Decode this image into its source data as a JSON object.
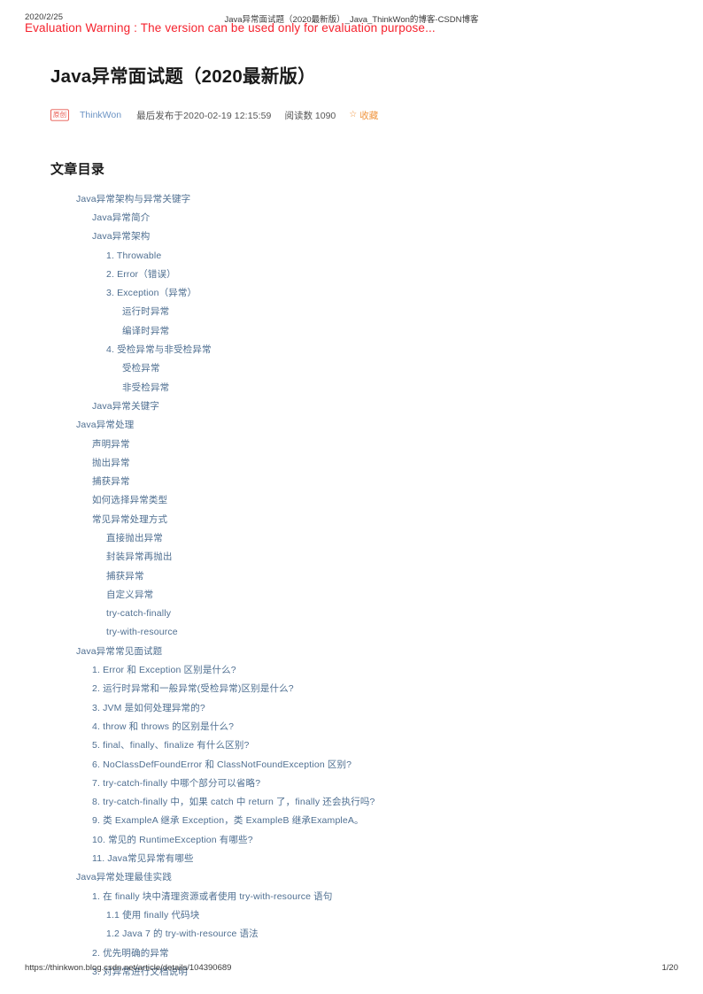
{
  "print_header": {
    "date": "2020/2/25",
    "document_title": "Java异常面试题（2020最新版）_Java_ThinkWon的博客-CSDN博客"
  },
  "overlay": {
    "evaluation_warning": "Evaluation Warning : The version can be used only for evaluation purpose..."
  },
  "article": {
    "title": "Java异常面试题（2020最新版）",
    "meta": {
      "badge": "原创",
      "author": "ThinkWon",
      "published": "最后发布于2020-02-19 12:15:59",
      "reads": "阅读数 1090",
      "favorite": "收藏",
      "star_icon": "☆"
    },
    "toc_heading": "文章目录",
    "toc": [
      {
        "level": 1,
        "label": "Java异常架构与异常关键字"
      },
      {
        "level": 2,
        "label": "Java异常简介"
      },
      {
        "level": 2,
        "label": "Java异常架构"
      },
      {
        "level": 3,
        "label": "1. Throwable"
      },
      {
        "level": 3,
        "label": "2. Error（错误）"
      },
      {
        "level": 3,
        "label": "3. Exception（异常）"
      },
      {
        "level": 4,
        "label": "运行时异常"
      },
      {
        "level": 4,
        "label": "编译时异常"
      },
      {
        "level": 3,
        "label": "4. 受检异常与非受检异常"
      },
      {
        "level": 4,
        "label": "受检异常"
      },
      {
        "level": 4,
        "label": "非受检异常"
      },
      {
        "level": 2,
        "label": "Java异常关键字"
      },
      {
        "level": 1,
        "label": "Java异常处理"
      },
      {
        "level": 2,
        "label": "声明异常"
      },
      {
        "level": 2,
        "label": "抛出异常"
      },
      {
        "level": 2,
        "label": "捕获异常"
      },
      {
        "level": 2,
        "label": "如何选择异常类型"
      },
      {
        "level": 2,
        "label": "常见异常处理方式"
      },
      {
        "level": 3,
        "label": "直接抛出异常"
      },
      {
        "level": 3,
        "label": "封装异常再抛出"
      },
      {
        "level": 3,
        "label": "捕获异常"
      },
      {
        "level": 3,
        "label": "自定义异常"
      },
      {
        "level": 3,
        "label": "try-catch-finally"
      },
      {
        "level": 3,
        "label": "try-with-resource"
      },
      {
        "level": 1,
        "label": "Java异常常见面试题"
      },
      {
        "level": 2,
        "label": "1. Error 和 Exception 区别是什么?"
      },
      {
        "level": 2,
        "label": "2. 运行时异常和一般异常(受检异常)区别是什么?"
      },
      {
        "level": 2,
        "label": "3. JVM 是如何处理异常的?"
      },
      {
        "level": 2,
        "label": "4. throw 和 throws 的区别是什么?"
      },
      {
        "level": 2,
        "label": "5. final、finally、finalize 有什么区别?"
      },
      {
        "level": 2,
        "label": "6. NoClassDefFoundError 和 ClassNotFoundException 区别?"
      },
      {
        "level": 2,
        "label": "7. try-catch-finally 中哪个部分可以省略?"
      },
      {
        "level": 2,
        "label": "8. try-catch-finally 中，如果 catch 中 return 了，finally 还会执行吗?"
      },
      {
        "level": 2,
        "label": "9. 类 ExampleA 继承 Exception，类 ExampleB 继承ExampleA。"
      },
      {
        "level": 2,
        "label": "10. 常见的 RuntimeException 有哪些?"
      },
      {
        "level": 2,
        "label": "11. Java常见异常有哪些"
      },
      {
        "level": 1,
        "label": "Java异常处理最佳实践"
      },
      {
        "level": 2,
        "label": "1. 在 finally 块中清理资源或者使用 try-with-resource 语句"
      },
      {
        "level": 3,
        "label": "1.1 使用 finally 代码块"
      },
      {
        "level": 3,
        "label": "1.2 Java 7 的 try-with-resource 语法"
      },
      {
        "level": 2,
        "label": "2. 优先明确的异常"
      },
      {
        "level": 2,
        "label": "3. 对异常进行文档说明"
      }
    ]
  },
  "print_footer": {
    "url": "https://thinkwon.blog.csdn.net/article/details/104390689",
    "page": "1/20"
  },
  "colors": {
    "link": "#4f6f91",
    "author": "#6b93c4",
    "badge": "#e8584f",
    "favorite": "#f0953f",
    "warning": "#f5222d"
  }
}
